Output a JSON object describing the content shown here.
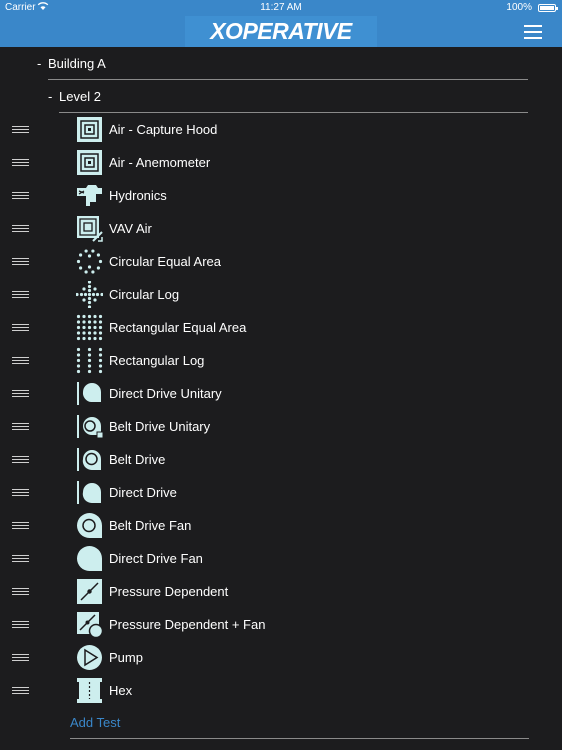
{
  "status": {
    "carrier": "Carrier",
    "time": "11:27 AM",
    "battery": "100%"
  },
  "header": {
    "logo": "XOPERATIVE",
    "brand_color": "#3a87c9"
  },
  "tree": {
    "building": {
      "toggle": "-",
      "label": "Building A"
    },
    "level": {
      "toggle": "-",
      "label": "Level 2"
    }
  },
  "tests": [
    {
      "label": "Air - Capture Hood",
      "icon": "capture-hood-icon"
    },
    {
      "label": "Air - Anemometer",
      "icon": "anemometer-icon"
    },
    {
      "label": "Hydronics",
      "icon": "hydronics-icon"
    },
    {
      "label": "VAV Air",
      "icon": "vav-air-icon"
    },
    {
      "label": "Circular Equal Area",
      "icon": "circular-equal-area-icon"
    },
    {
      "label": "Circular Log",
      "icon": "circular-log-icon"
    },
    {
      "label": "Rectangular Equal Area",
      "icon": "rectangular-equal-area-icon"
    },
    {
      "label": "Rectangular Log",
      "icon": "rectangular-log-icon"
    },
    {
      "label": "Direct Drive Unitary",
      "icon": "direct-drive-unitary-icon"
    },
    {
      "label": "Belt Drive Unitary",
      "icon": "belt-drive-unitary-icon"
    },
    {
      "label": "Belt Drive",
      "icon": "belt-drive-icon"
    },
    {
      "label": "Direct Drive",
      "icon": "direct-drive-icon"
    },
    {
      "label": "Belt Drive Fan",
      "icon": "belt-drive-fan-icon"
    },
    {
      "label": "Direct Drive Fan",
      "icon": "direct-drive-fan-icon"
    },
    {
      "label": "Pressure Dependent",
      "icon": "pressure-dependent-icon"
    },
    {
      "label": "Pressure Dependent + Fan",
      "icon": "pressure-dependent-fan-icon"
    },
    {
      "label": "Pump",
      "icon": "pump-icon"
    },
    {
      "label": "Hex",
      "icon": "hex-icon"
    }
  ],
  "add_test_label": "Add Test",
  "colors": {
    "background": "#1c1c1e",
    "icon_fill": "#cdeeee",
    "link": "#3a87c9"
  }
}
